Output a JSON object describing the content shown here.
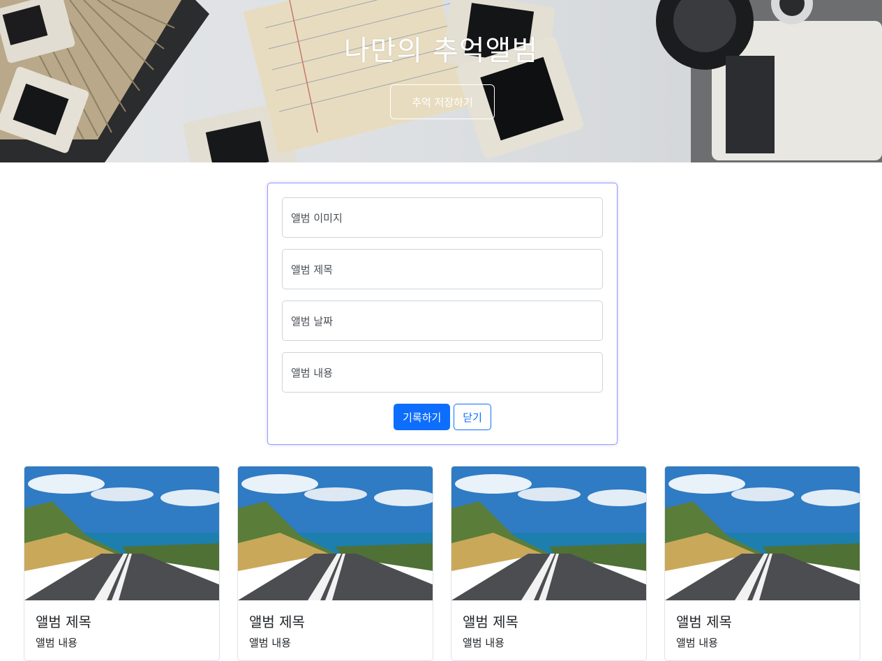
{
  "hero": {
    "title": "나만의 추억앨범",
    "save_button": "추억 저장하기"
  },
  "form": {
    "fields": [
      {
        "placeholder": "앨범 이미지"
      },
      {
        "placeholder": "앨범 제목"
      },
      {
        "placeholder": "앨범 날짜"
      },
      {
        "placeholder": "앨범 내용"
      }
    ],
    "submit_label": "기록하기",
    "close_label": "닫기"
  },
  "cards": [
    {
      "title": "앨범 제목",
      "text": "앨범 내용"
    },
    {
      "title": "앨범 제목",
      "text": "앨범 내용"
    },
    {
      "title": "앨범 제목",
      "text": "앨범 내용"
    },
    {
      "title": "앨범 제목",
      "text": "앨범 내용"
    }
  ],
  "colors": {
    "primary": "#0d6efd",
    "form_border": "#9a99ff",
    "field_border": "#ced4da"
  }
}
